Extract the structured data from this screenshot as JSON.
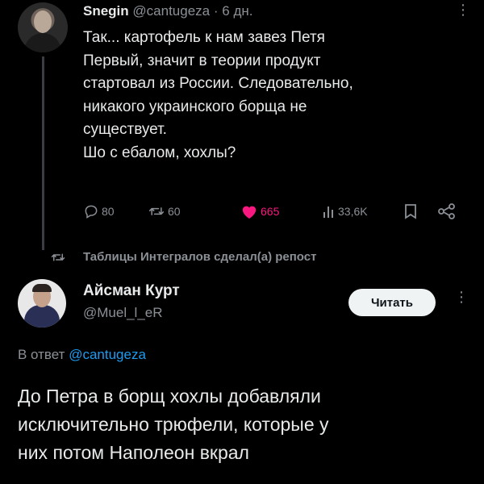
{
  "parent_tweet": {
    "author_name": "Snegin",
    "author_handle": "@cantugeza",
    "separator": "·",
    "time": "6 дн.",
    "more": "⋮",
    "text_lines": [
      "Так... картофель к нам завез Петя",
      "Первый, значит в теории продукт",
      "стартовал из России. Следовательно,",
      "никакого украинского борща не",
      "существует.",
      "Шо с ебалом, хохлы?"
    ],
    "actions": {
      "replies": "80",
      "reposts": "60",
      "likes": "665",
      "views": "33,6K"
    },
    "colors": {
      "like": "#f91880",
      "muted": "#8b9096"
    }
  },
  "repost_banner": {
    "text": "Таблицы Интегралов сделал(а) репост"
  },
  "reply_tweet": {
    "author_name": "Айсман Курт",
    "author_handle": "@Muel_l_eR",
    "follow_label": "Читать",
    "more": "⋮",
    "reply_to_prefix": "В ответ",
    "reply_to_handle": "@cantugeza",
    "text_lines": [
      "До Петра в борщ хохлы добавляли",
      "исключительно трюфели, которые у",
      "них потом Наполеон вкрал"
    ],
    "colors": {
      "link": "#1d9bf0"
    }
  }
}
